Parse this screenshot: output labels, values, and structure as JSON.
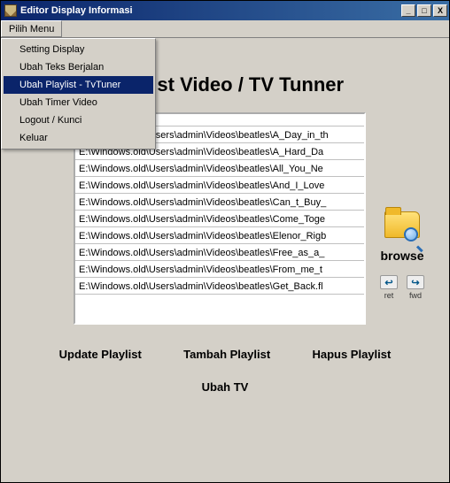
{
  "window": {
    "title": "Editor Display Informasi",
    "buttons": {
      "min": "_",
      "max": "□",
      "close": "X"
    }
  },
  "menubar": {
    "pilih_menu": "Pilih Menu",
    "items": [
      "Setting Display",
      "Ubah Teks Berjalan",
      "Ubah Playlist - TvTuner",
      "Ubah Timer Video",
      "Logout / Kunci",
      "Keluar"
    ],
    "selected_index": 2
  },
  "heading": "Playlist Video / TV Tunner",
  "playlist": {
    "header": "",
    "items": [
      "E:\\Windows.old\\Users\\admin\\Videos\\beatles\\A_Day_in_th",
      "E:\\Windows.old\\Users\\admin\\Videos\\beatles\\A_Hard_Da",
      "E:\\Windows.old\\Users\\admin\\Videos\\beatles\\All_You_Ne",
      "E:\\Windows.old\\Users\\admin\\Videos\\beatles\\And_I_Love",
      "E:\\Windows.old\\Users\\admin\\Videos\\beatles\\Can_t_Buy_",
      "E:\\Windows.old\\Users\\admin\\Videos\\beatles\\Come_Toge",
      "E:\\Windows.old\\Users\\admin\\Videos\\beatles\\Elenor_Rigb",
      "E:\\Windows.old\\Users\\admin\\Videos\\beatles\\Free_as_a_",
      "E:\\Windows.old\\Users\\admin\\Videos\\beatles\\From_me_t",
      "E:\\Windows.old\\Users\\admin\\Videos\\beatles\\Get_Back.fl"
    ]
  },
  "side": {
    "browse": "browse",
    "ret": "ret",
    "fwd": "fwd"
  },
  "buttons": {
    "update": "Update Playlist",
    "tambah": "Tambah  Playlist",
    "hapus": "Hapus Playlist",
    "ubahtv": "Ubah TV"
  }
}
